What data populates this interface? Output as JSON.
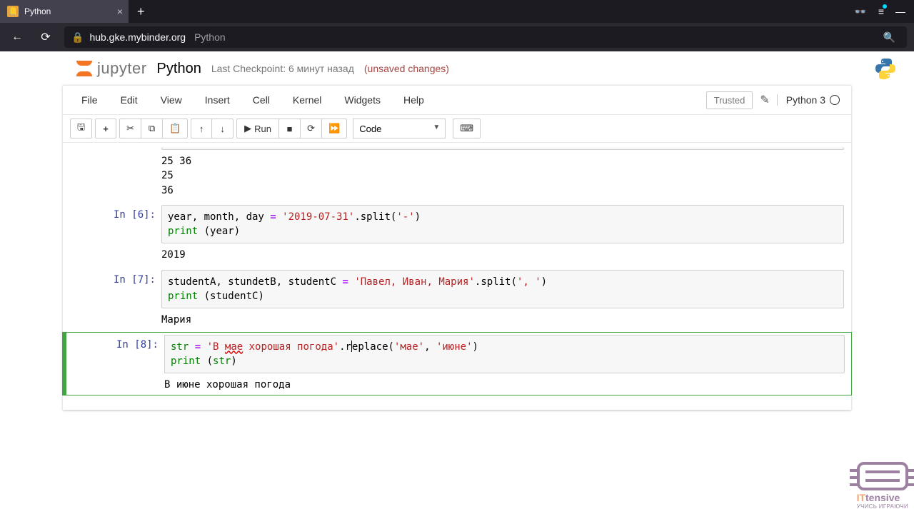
{
  "browser": {
    "tab_title": "Python",
    "url_domain": "hub.gke.mybinder.org",
    "url_path": "Python"
  },
  "header": {
    "logo_text": "jupyter",
    "title": "Python",
    "checkpoint": "Last Checkpoint: 6 минут назад",
    "unsaved": "(unsaved changes)"
  },
  "menu": {
    "items": [
      "File",
      "Edit",
      "View",
      "Insert",
      "Cell",
      "Kernel",
      "Widgets",
      "Help"
    ],
    "trusted": "Trusted",
    "kernel": "Python 3"
  },
  "toolbar": {
    "run_label": "Run",
    "celltype": "Code"
  },
  "cells": {
    "out_top": "25 36\n25\n36",
    "p6": "In [6]:",
    "code6_l1_a": "year, month, day ",
    "code6_l1_eq": "=",
    "code6_l1_b": " ",
    "code6_l1_str": "'2019-07-31'",
    "code6_l1_c": ".split(",
    "code6_l1_str2": "'-'",
    "code6_l1_d": ")",
    "code6_l2_a": "print",
    "code6_l2_b": " (year)",
    "out6": "2019",
    "p7": "In [7]:",
    "code7_l1_a": "studentA, stundetB, studentC ",
    "code7_l1_eq": "=",
    "code7_l1_b": " ",
    "code7_l1_str": "'Павел, Иван, Мария'",
    "code7_l1_c": ".split(",
    "code7_l1_str2": "', '",
    "code7_l1_d": ")",
    "code7_l2_a": "print",
    "code7_l2_b": " (studentC)",
    "out7": "Мария",
    "p8": "In [8]:",
    "code8_l1_a": "str",
    "code8_l1_sp": " ",
    "code8_l1_eq": "=",
    "code8_l1_b": " ",
    "code8_l1_str_open": "'В ",
    "code8_l1_str_mae": "мае",
    "code8_l1_str_rest": " хорошая погода'",
    "code8_l1_c1": ".r",
    "code8_l1_c2": "eplace(",
    "code8_l1_str2": "'мае'",
    "code8_l1_comma": ", ",
    "code8_l1_str3": "'июне'",
    "code8_l1_d": ")",
    "code8_l2_a": "print",
    "code8_l2_b": " (",
    "code8_l2_c": "str",
    "code8_l2_d": ")",
    "out8": "В июне хорошая погода"
  },
  "watermark": {
    "brand_it": "IT",
    "brand_rest": "tensive",
    "sub": "УЧИСЬ ИГРАЮЧИ"
  }
}
